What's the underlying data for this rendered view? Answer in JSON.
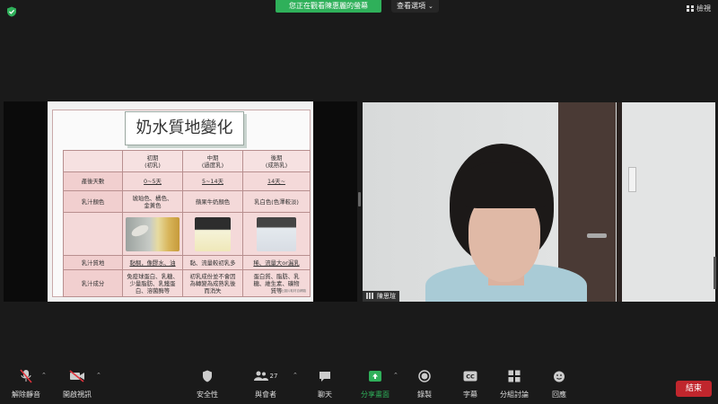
{
  "banner": {
    "text": "您正在觀看陳惠麗的螢幕"
  },
  "top": {
    "view_options": "查看選項",
    "view_mode": "檢視"
  },
  "slide": {
    "title": "奶水質地變化",
    "headers": [
      "",
      "初期\n(初乳)",
      "中期\n(過度乳)",
      "後期\n(成熟乳)"
    ],
    "rows": [
      {
        "label": "產後天數",
        "cells": [
          "0~5天",
          "5~14天",
          "14天~"
        ]
      },
      {
        "label": "乳汁顏色",
        "cells": [
          "琥珀色、橘色、\n金黃色",
          "蘋果牛奶顏色",
          "乳白色(色澤較淡)"
        ]
      },
      {
        "label": "",
        "cells": [
          "",
          "",
          ""
        ]
      },
      {
        "label": "乳汁質地",
        "cells": [
          "黏稠，像膠水、油",
          "黏、流量較初乳多",
          "稀、流量大or漏乳"
        ]
      },
      {
        "label": "乳汁成分",
        "cells": [
          "免疫球蛋白、乳糖、\n少量脂肪、乳鐵蛋\n白、溶菌酶等",
          "初乳成份並不會因\n為轉變為成熟乳後\n而消失",
          "蛋白質、脂肪、乳\n糖、維生素、礦物\n質等"
        ]
      }
    ],
    "footnote": "*以上圖片取材自網路"
  },
  "cam": {
    "name": "陳思瑄"
  },
  "toolbar": {
    "unmute": "解除靜音",
    "start_video": "開啟視訊",
    "security": "安全性",
    "participants": "與會者",
    "participants_count": "27",
    "chat": "聊天",
    "share_screen": "分享畫面",
    "record": "錄製",
    "captions": "字幕",
    "breakout": "分組討論",
    "reactions": "回應",
    "end": "結束"
  },
  "colors": {
    "accent_green": "#2fb05a",
    "end_red": "#c0262d",
    "background": "#1a1a1a"
  },
  "icons": [
    "shield-check-icon",
    "grid-icon",
    "mic-off-icon",
    "video-off-icon",
    "security-shield-icon",
    "participants-icon",
    "chat-icon",
    "share-screen-icon",
    "record-icon",
    "cc-icon",
    "breakout-icon",
    "reactions-icon",
    "signal-bars-icon"
  ]
}
